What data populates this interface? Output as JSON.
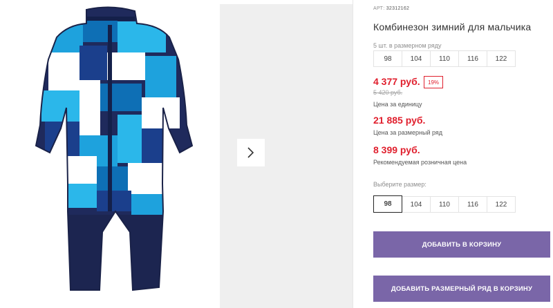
{
  "product": {
    "image_alt": "Комбинезон зимний для мальчика",
    "art_label": "АРТ:",
    "art_value": "32312162",
    "title": "Комбинезон зимний для мальчика"
  },
  "size_set": {
    "note": "5 шт. в размерном ряду",
    "sizes": [
      "98",
      "104",
      "110",
      "116",
      "122"
    ]
  },
  "prices": {
    "unit_price": "4 377 руб.",
    "discount": "19%",
    "old_price": "5 420 руб.",
    "unit_caption": "Цена за единицу",
    "set_price": "21 885 руб.",
    "set_caption": "Цена за размерный ряд",
    "retail_price": "8 399 руб.",
    "retail_caption": "Рекомендуемая розничная цена"
  },
  "size_select": {
    "label": "Выберите размер:",
    "sizes": [
      "98",
      "104",
      "110",
      "116",
      "122"
    ],
    "selected": "98"
  },
  "actions": {
    "add_to_cart": "ДОБАВИТЬ В КОРЗИНУ",
    "add_set_to_cart": "ДОБАВИТЬ РАЗМЕРНЫЙ РЯД В КОРЗИНУ"
  },
  "icons": {
    "next": "chevron-right-icon"
  },
  "colors": {
    "price_red": "#e01f2d",
    "button_purple": "#7a66a8"
  }
}
